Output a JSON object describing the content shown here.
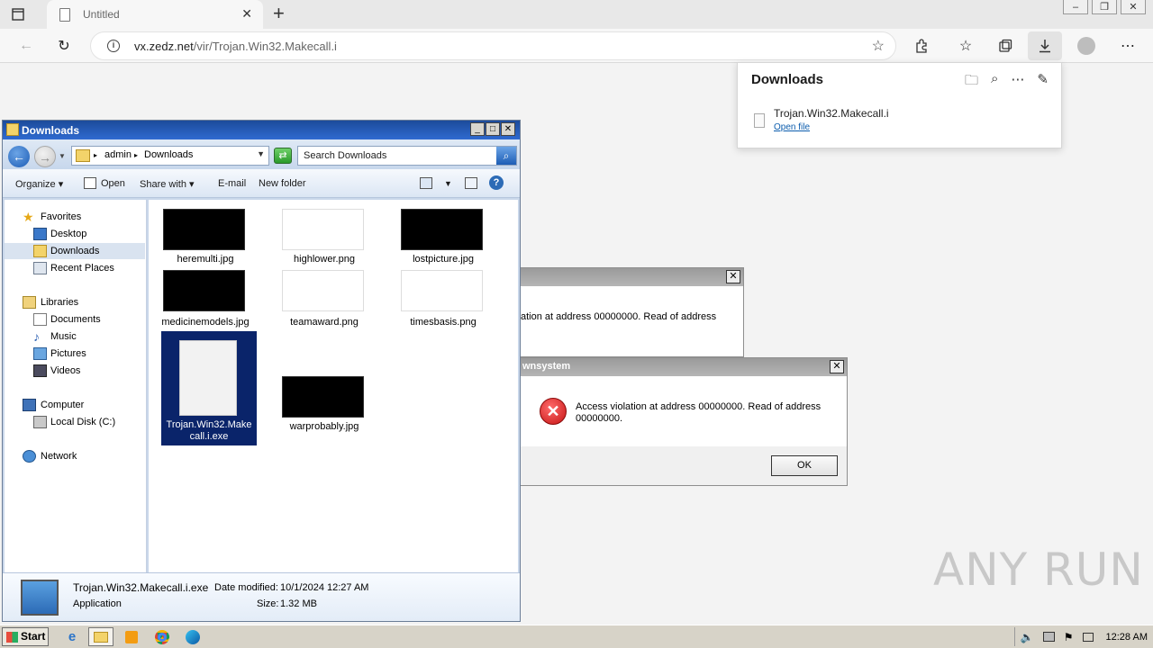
{
  "browser": {
    "tab_title": "Untitled",
    "url_host": "vx.zedz.net",
    "url_path": "/vir/Trojan.Win32.Makecall.i",
    "downloads_panel": {
      "title": "Downloads",
      "file_name": "Trojan.Win32.Makecall.i",
      "open_link": "Open file"
    }
  },
  "explorer": {
    "title": "Downloads",
    "breadcrumb": [
      "admin",
      "Downloads"
    ],
    "search_placeholder": "Search Downloads",
    "commands": {
      "organize": "Organize",
      "open": "Open",
      "share_with": "Share with",
      "email": "E-mail",
      "new_folder": "New folder"
    },
    "nav": {
      "favorites": "Favorites",
      "desktop": "Desktop",
      "downloads": "Downloads",
      "recent_places": "Recent Places",
      "libraries": "Libraries",
      "documents": "Documents",
      "music": "Music",
      "pictures": "Pictures",
      "videos": "Videos",
      "computer": "Computer",
      "local_disk": "Local Disk (C:)",
      "network": "Network"
    },
    "files": [
      {
        "name": "heremulti.jpg",
        "thumb": "#000000"
      },
      {
        "name": "highlower.png",
        "thumb": "#ffffff"
      },
      {
        "name": "lostpicture.jpg",
        "thumb": "#000000"
      },
      {
        "name": "medicinemodels.jpg",
        "thumb": "#000000"
      },
      {
        "name": "teamaward.png",
        "thumb": "#ffffff"
      },
      {
        "name": "timesbasis.png",
        "thumb": "#ffffff"
      },
      {
        "name": "Trojan.Win32.Make call.i.exe",
        "thumb": "file"
      },
      {
        "name": "warprobably.jpg",
        "thumb": "#000000"
      }
    ],
    "details": {
      "file_name": "Trojan.Win32.Makecall.i.exe",
      "type": "Application",
      "date_label": "Date modified:",
      "date_value": "10/1/2024 12:27 AM",
      "size_label": "Size:",
      "size_value": "1.32 MB"
    }
  },
  "dialog_back": {
    "message": "ation at address 00000000. Read of address"
  },
  "dialog_front": {
    "title": "wnsystem",
    "message_line1": "Access violation at address 00000000. Read of address",
    "message_line2": "00000000.",
    "ok_label": "OK"
  },
  "taskbar": {
    "start_label": "Start",
    "clock": "12:28 AM"
  },
  "watermark": "ANY RUN",
  "colors": {
    "xp_title_blue": "#2f6ad0",
    "selection_blue": "#0a246a",
    "error_red": "#c61414"
  }
}
